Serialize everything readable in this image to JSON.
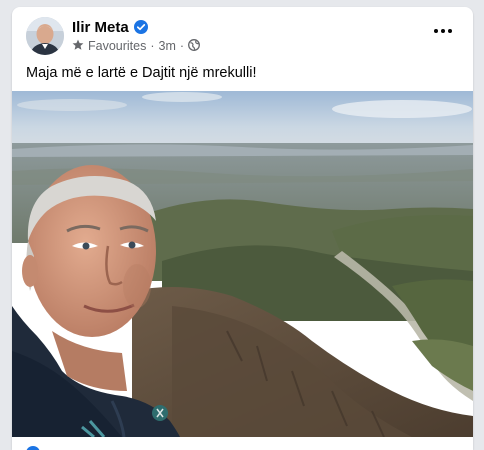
{
  "post": {
    "author": "Ilir Meta",
    "audience": "Favourites",
    "time": "3m",
    "separator": "·",
    "caption": "Maja më e lartë e Dajtit një mrekulli!"
  },
  "icons": {
    "verified": "verified-badge-icon",
    "star": "star-icon",
    "globe": "globe-icon",
    "more": "more-options-icon"
  },
  "colors": {
    "verified": "#1b74e4",
    "meta_text": "#65676b",
    "author_text": "#050505"
  }
}
